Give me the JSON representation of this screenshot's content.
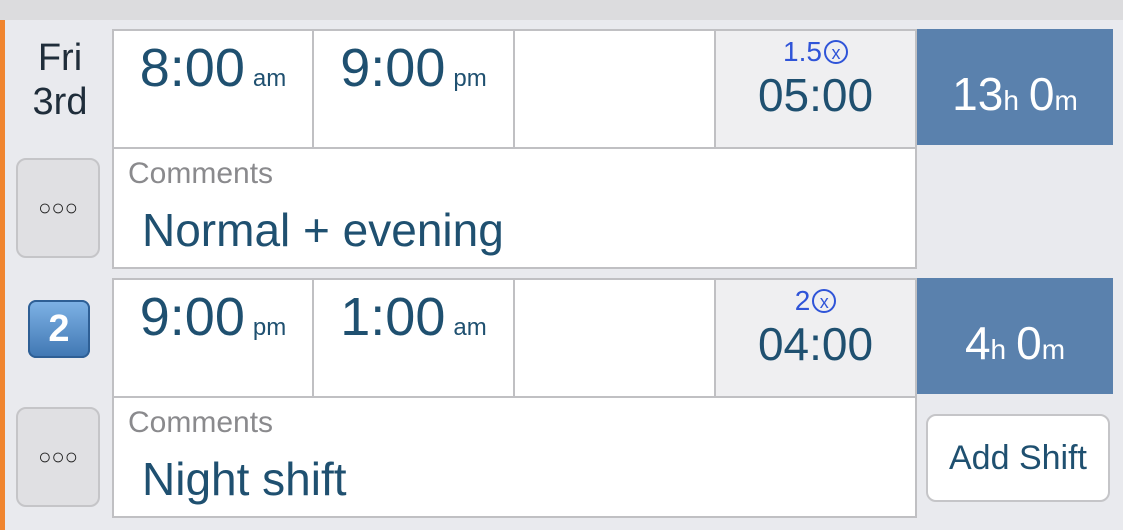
{
  "day": {
    "weekday": "Fri",
    "date": "3rd"
  },
  "shifts": [
    {
      "start_time": "8:00",
      "start_ampm": "am",
      "end_time": "9:00",
      "end_ampm": "pm",
      "break": "",
      "ot_multiplier": "1.5",
      "ot_remove_symbol": "x",
      "ot_hours": "05:00",
      "total_hours": "13",
      "total_h_unit": "h",
      "total_minutes": "0",
      "total_m_unit": "m",
      "comments_label": "Comments",
      "comment": "Normal + evening",
      "more_label": "○○○"
    },
    {
      "badge": "2",
      "start_time": "9:00",
      "start_ampm": "pm",
      "end_time": "1:00",
      "end_ampm": "am",
      "break": "",
      "ot_multiplier": "2",
      "ot_remove_symbol": "x",
      "ot_hours": "04:00",
      "total_hours": "4",
      "total_h_unit": "h",
      "total_minutes": "0",
      "total_m_unit": "m",
      "comments_label": "Comments",
      "comment": "Night shift",
      "more_label": "○○○"
    }
  ],
  "add_shift_label": "Add Shift",
  "colors": {
    "accent": "#f0852f",
    "total_bg": "#5a81ad",
    "text": "#1f5070",
    "ot_blue": "#2f54d8"
  }
}
